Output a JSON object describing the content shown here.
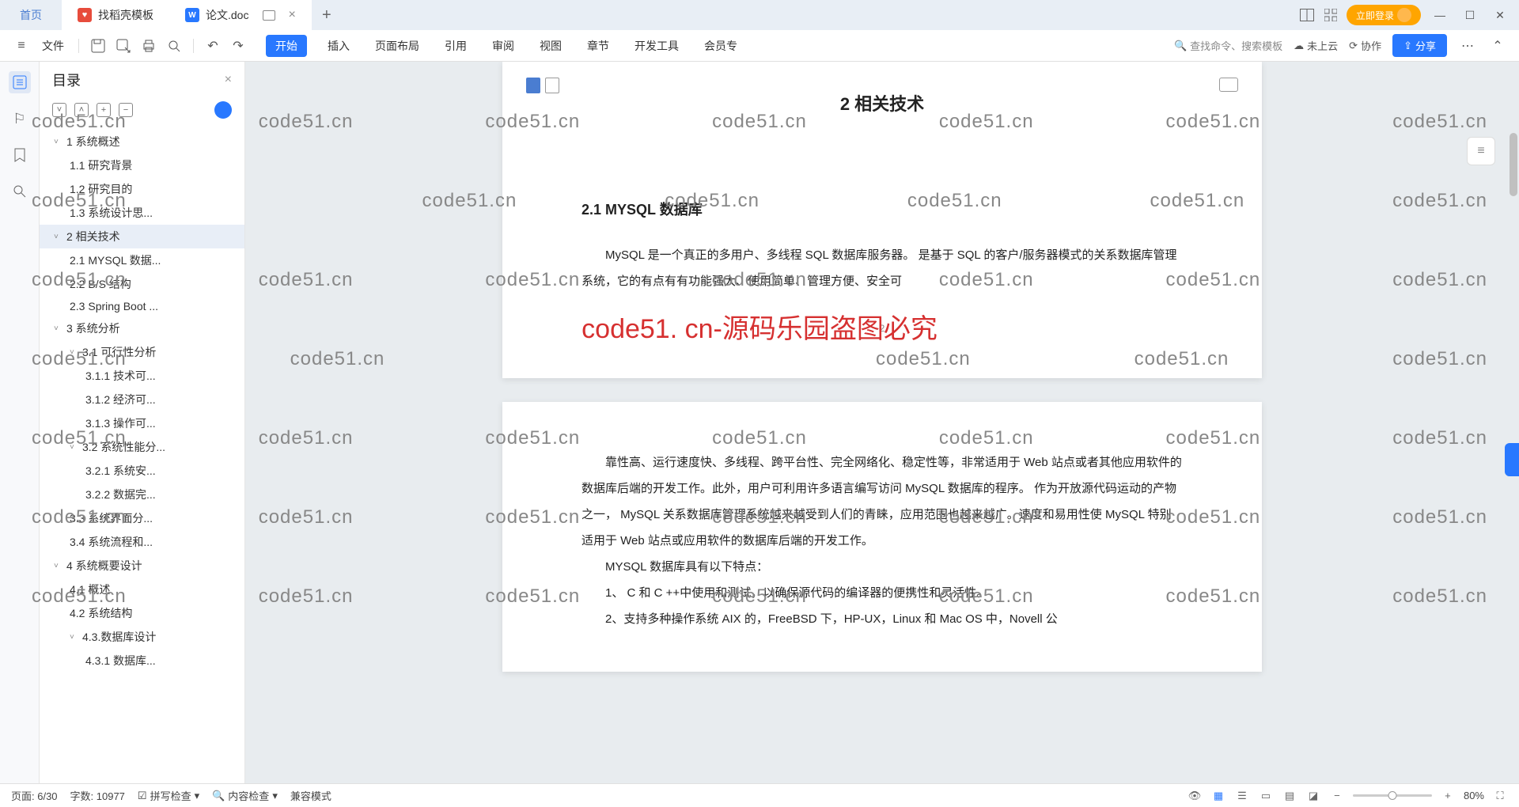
{
  "tabs": {
    "home": "首页",
    "template": "找稻壳模板",
    "doc": "论文.doc"
  },
  "titlebar": {
    "login": "立即登录"
  },
  "toolbar": {
    "file": "文件",
    "menus": [
      "开始",
      "插入",
      "页面布局",
      "引用",
      "审阅",
      "视图",
      "章节",
      "开发工具",
      "会员专"
    ],
    "search": "查找命令、搜索模板",
    "cloud": "未上云",
    "collab": "协作",
    "share": "分享"
  },
  "outline": {
    "title": "目录",
    "items": [
      {
        "l": 1,
        "chev": true,
        "t": "1 系统概述"
      },
      {
        "l": 2,
        "t": "1.1 研究背景"
      },
      {
        "l": 2,
        "t": "1.2 研究目的"
      },
      {
        "l": 2,
        "t": "1.3 系统设计思..."
      },
      {
        "l": 1,
        "chev": true,
        "t": "2 相关技术",
        "active": true
      },
      {
        "l": 2,
        "t": "2.1 MYSQL 数据..."
      },
      {
        "l": 2,
        "t": "2.2 B/S 结构"
      },
      {
        "l": 2,
        "t": "2.3 Spring Boot ..."
      },
      {
        "l": 1,
        "chev": true,
        "t": "3 系统分析"
      },
      {
        "l": 2,
        "chev": true,
        "t": "3.1 可行性分析"
      },
      {
        "l": 3,
        "t": "3.1.1 技术可..."
      },
      {
        "l": 3,
        "t": "3.1.2 经济可..."
      },
      {
        "l": 3,
        "t": "3.1.3 操作可..."
      },
      {
        "l": 2,
        "chev": true,
        "t": "3.2 系统性能分..."
      },
      {
        "l": 3,
        "t": "3.2.1 系统安..."
      },
      {
        "l": 3,
        "t": "3.2.2 数据完..."
      },
      {
        "l": 2,
        "t": "3.3 系统界面分..."
      },
      {
        "l": 2,
        "t": "3.4 系统流程和..."
      },
      {
        "l": 1,
        "chev": true,
        "t": "4 系统概要设计"
      },
      {
        "l": 2,
        "t": "4.1 概述"
      },
      {
        "l": 2,
        "t": "4.2 系统结构"
      },
      {
        "l": 2,
        "chev": true,
        "t": "4.3.数据库设计"
      },
      {
        "l": 3,
        "t": "4.3.1 数据库..."
      }
    ]
  },
  "doc": {
    "h1": "2 相关技术",
    "h2": "2.1 MYSQL 数据库",
    "p1": "MySQL 是一个真正的多用户、多线程 SQL 数据库服务器。  是基于 SQL 的客户/服务器模式的关系数据库管理系统，它的有点有有功能强大、使用简单、管理方便、安全可",
    "pagenum": "2",
    "p2": "靠性高、运行速度快、多线程、跨平台性、完全网络化、稳定性等，非常适用于 Web 站点或者其他应用软件的数据库后端的开发工作。此外，用户可利用许多语言编写访问 MySQL 数据库的程序。 作为开放源代码运动的产物之一， MySQL 关系数据库管理系统越来越受到人们的青睐，应用范围也越来越广。速度和易用性使 MySQL 特别适用于 Web 站点或应用软件的数据库后端的开发工作。",
    "p3": "MYSQL 数据库具有以下特点：",
    "p4": "1、 C 和 C ++中使用和测试，以确保源代码的编译器的便携性和灵活性。",
    "p5": "2、支持多种操作系统 AIX 的，FreeBSD 下，HP-UX，Linux 和 Mac OS 中，Novell 公"
  },
  "watermark": {
    "grey": "code51.cn",
    "red": "code51. cn-源码乐园盗图必究"
  },
  "status": {
    "page": "页面: 6/30",
    "words": "字数: 10977",
    "spell": "拼写检查",
    "content": "内容检查",
    "compat": "兼容模式",
    "zoom": "80%"
  }
}
